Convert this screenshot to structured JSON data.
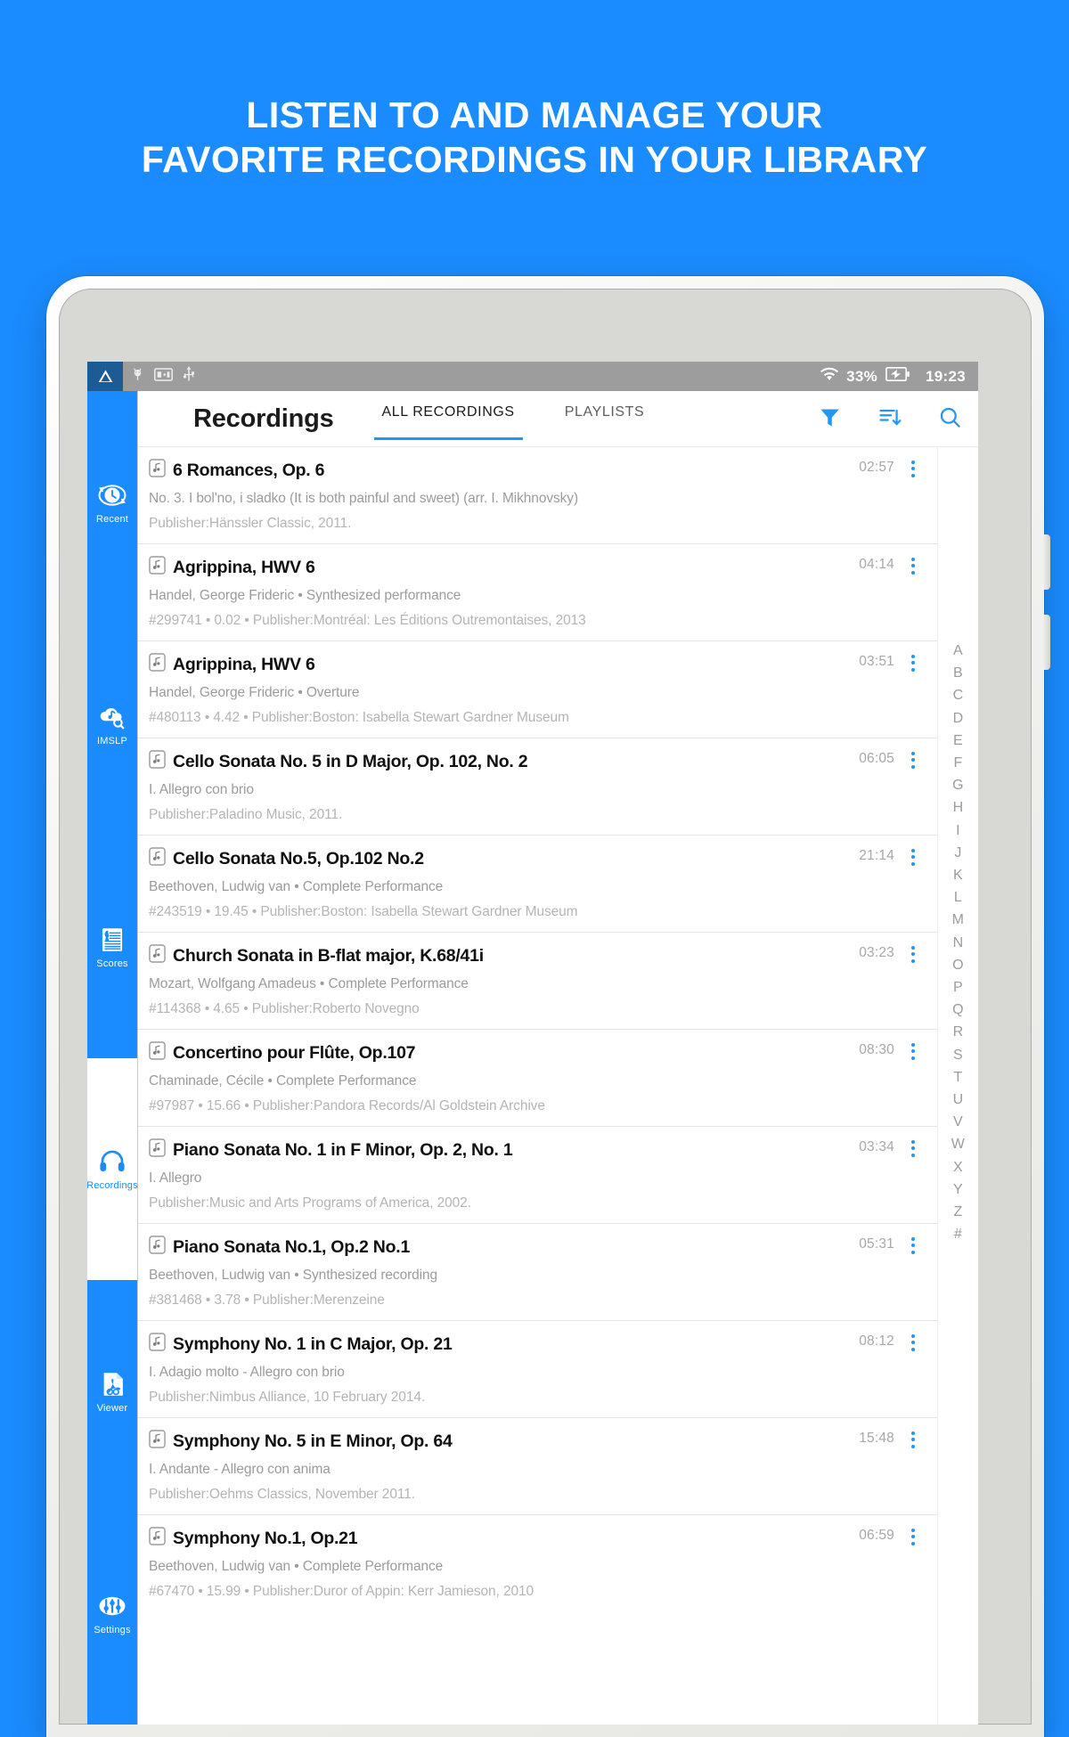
{
  "promo": {
    "line1": "LISTEN TO AND MANAGE YOUR",
    "line2": "FAVORITE RECORDINGS IN YOUR LIBRARY"
  },
  "theme": {
    "brand_blue": "#1a8cff",
    "accent_blue": "#2196f3",
    "statusbar_gray": "#9d9d9d",
    "warn_badge_blue": "#1d5b94"
  },
  "statusbar": {
    "left_icons": [
      "warning-icon",
      "adb-icon",
      "cast-icon",
      "usb-icon"
    ],
    "wifi_icon": "wifi-icon",
    "battery_percent": "33%",
    "battery_icon": "battery-charging-icon",
    "time": "19:23"
  },
  "sidebar": {
    "items": [
      {
        "label": "Recent",
        "icon": "recent-clock-icon",
        "active": false
      },
      {
        "label": "IMSLP",
        "icon": "imslp-cloud-search-icon",
        "active": false
      },
      {
        "label": "Scores",
        "icon": "scores-sheet-icon",
        "active": false
      },
      {
        "label": "Recordings",
        "icon": "headphones-icon",
        "active": true
      },
      {
        "label": "Viewer",
        "icon": "pdf-viewer-icon",
        "active": false
      },
      {
        "label": "Settings",
        "icon": "settings-sliders-icon",
        "active": false
      }
    ]
  },
  "header": {
    "title": "Recordings",
    "tabs": [
      {
        "label": "ALL RECORDINGS",
        "active": true
      },
      {
        "label": "PLAYLISTS",
        "active": false
      }
    ],
    "actions": [
      {
        "name": "filter-icon",
        "label": "Filter"
      },
      {
        "name": "sort-icon",
        "label": "Sort"
      },
      {
        "name": "search-icon",
        "label": "Search"
      }
    ]
  },
  "recordings": [
    {
      "title": "6 Romances, Op. 6",
      "subtitle": "No. 3. I bol'no, i sladko (It is both painful and sweet) (arr. I. Mikhnovsky)",
      "meta": "Publisher:Hänssler Classic, 2011.",
      "duration": "02:57"
    },
    {
      "title": "Agrippina, HWV 6",
      "subtitle": "Handel, George Frideric • Synthesized performance",
      "meta": "#299741 • 0.02 • Publisher:Montréal: Les Éditions Outremontaises, 2013",
      "duration": "04:14"
    },
    {
      "title": "Agrippina, HWV 6",
      "subtitle": "Handel, George Frideric • Overture",
      "meta": "#480113 • 4.42 • Publisher:Boston: Isabella Stewart Gardner Museum",
      "duration": "03:51"
    },
    {
      "title": "Cello Sonata No. 5 in D Major, Op. 102, No. 2",
      "subtitle": "I. Allegro con brio",
      "meta": "Publisher:Paladino Music, 2011.",
      "duration": "06:05"
    },
    {
      "title": "Cello Sonata No.5, Op.102 No.2",
      "subtitle": "Beethoven, Ludwig van • Complete Performance",
      "meta": "#243519 • 19.45 • Publisher:Boston: Isabella Stewart Gardner Museum",
      "duration": "21:14"
    },
    {
      "title": "Church Sonata in B-flat major, K.68/41i",
      "subtitle": "Mozart, Wolfgang Amadeus • Complete Performance",
      "meta": "#114368 • 4.65 • Publisher:Roberto Novegno",
      "duration": "03:23"
    },
    {
      "title": "Concertino pour Flûte, Op.107",
      "subtitle": "Chaminade, Cécile • Complete Performance",
      "meta": "#97987 • 15.66 • Publisher:Pandora Records/Al Goldstein Archive",
      "duration": "08:30"
    },
    {
      "title": "Piano Sonata No. 1 in F Minor, Op. 2, No. 1",
      "subtitle": "I. Allegro",
      "meta": "Publisher:Music and Arts Programs of America, 2002.",
      "duration": "03:34"
    },
    {
      "title": "Piano Sonata No.1, Op.2 No.1",
      "subtitle": "Beethoven, Ludwig van • Synthesized recording",
      "meta": "#381468 • 3.78 • Publisher:Merenzeine",
      "duration": "05:31"
    },
    {
      "title": "Symphony No. 1 in C Major, Op. 21",
      "subtitle": "I. Adagio molto - Allegro con brio",
      "meta": "Publisher:Nimbus Alliance, 10 February 2014.",
      "duration": "08:12"
    },
    {
      "title": "Symphony No. 5 in E Minor, Op. 64",
      "subtitle": "I. Andante - Allegro con anima",
      "meta": "Publisher:Oehms Classics, November 2011.",
      "duration": "15:48"
    },
    {
      "title": "Symphony No.1, Op.21",
      "subtitle": "Beethoven, Ludwig van • Complete Performance",
      "meta": "#67470 • 15.99 • Publisher:Duror of Appin: Kerr Jamieson, 2010",
      "duration": "06:59"
    }
  ],
  "alphabet_index": [
    "A",
    "B",
    "C",
    "D",
    "E",
    "F",
    "G",
    "H",
    "I",
    "J",
    "K",
    "L",
    "M",
    "N",
    "O",
    "P",
    "Q",
    "R",
    "S",
    "T",
    "U",
    "V",
    "W",
    "X",
    "Y",
    "Z",
    "#"
  ]
}
